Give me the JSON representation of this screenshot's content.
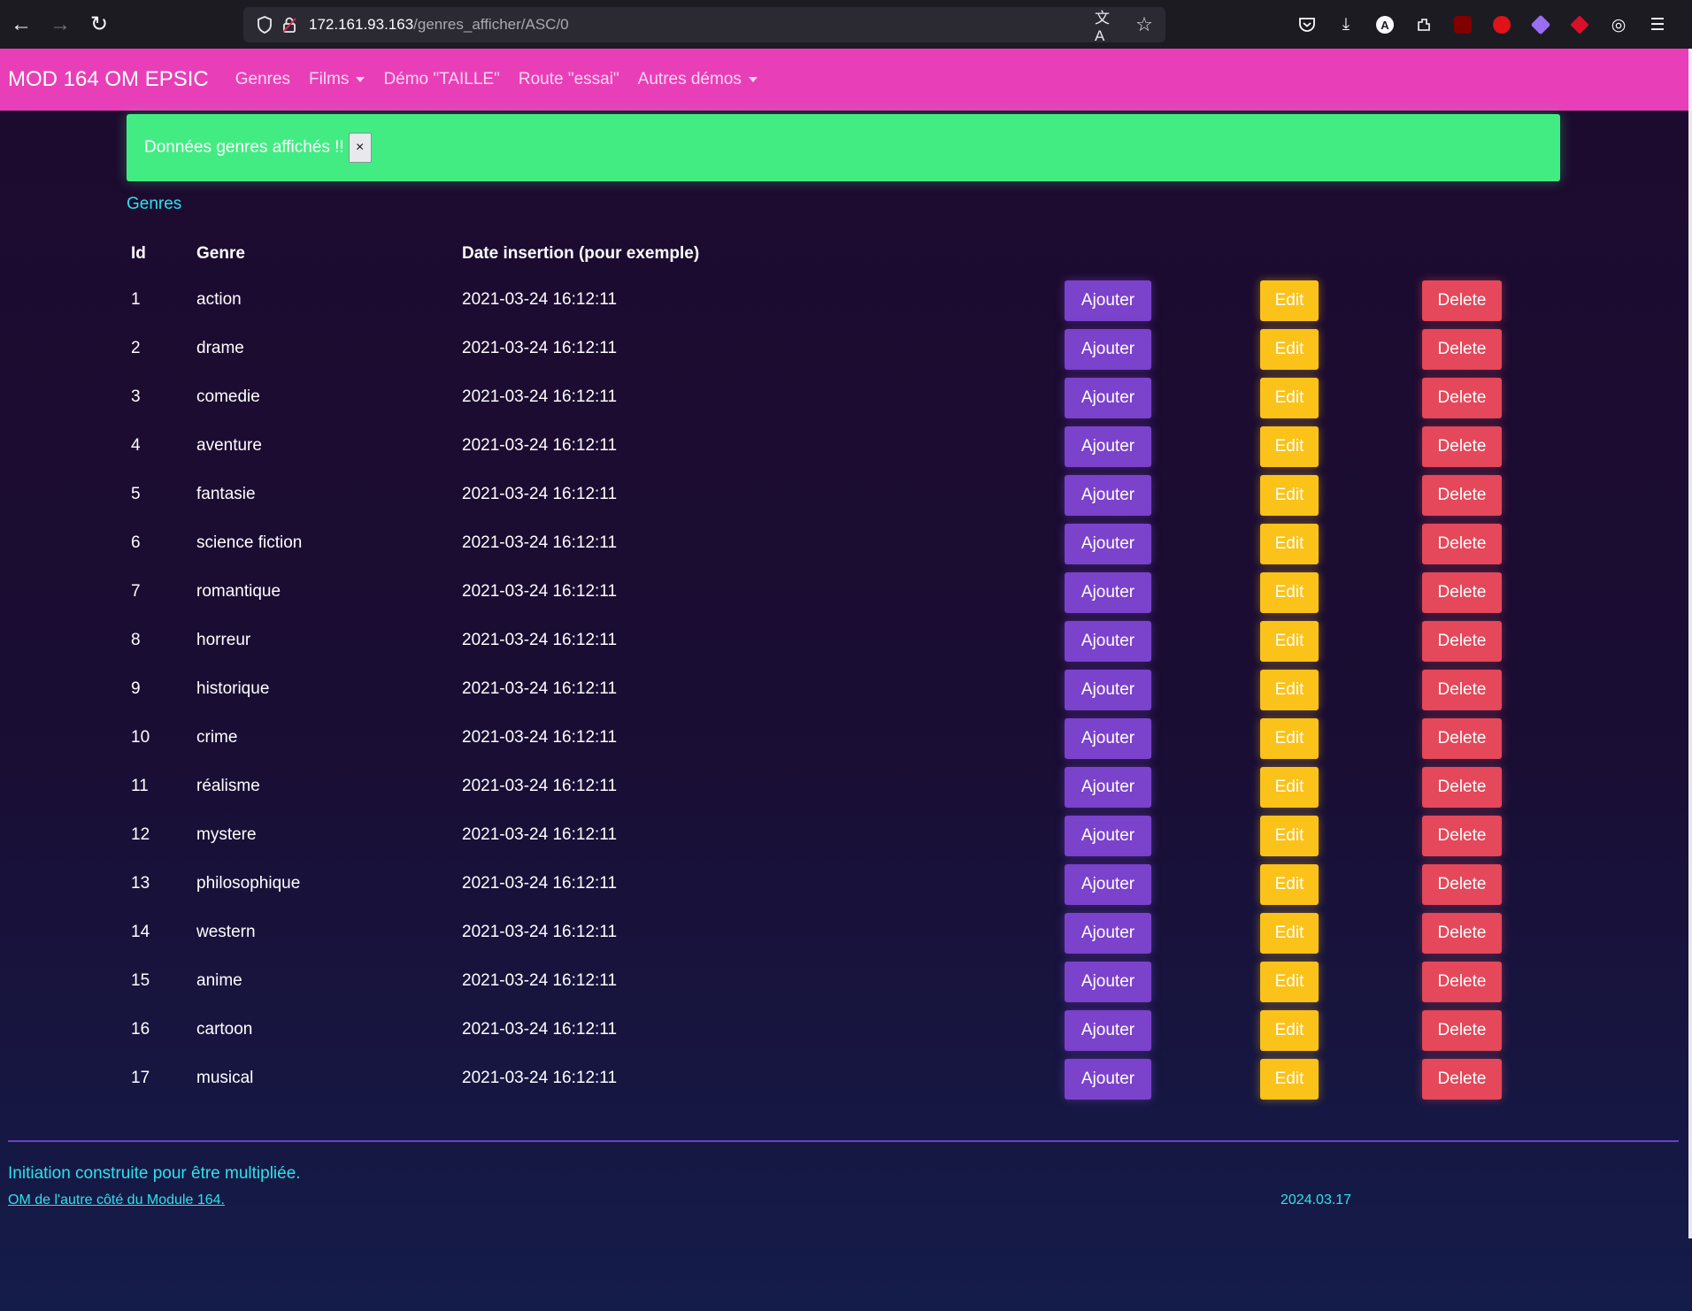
{
  "browser": {
    "url_host": "172.161.93.163",
    "url_path": "/genres_afficher/ASC/0"
  },
  "navbar": {
    "brand": "MOD 164 OM EPSIC",
    "items": [
      {
        "label": "Genres"
      },
      {
        "label": "Films"
      },
      {
        "label": "Démo \"TAILLE\""
      },
      {
        "label": "Route \"essai\""
      },
      {
        "label": "Autres démos"
      }
    ]
  },
  "alert": {
    "message": "Données genres affichés !!",
    "close": "×"
  },
  "section_title": "Genres",
  "table": {
    "headers": {
      "id": "Id",
      "genre": "Genre",
      "date": "Date insertion (pour exemple)"
    },
    "buttons": {
      "add": "Ajouter",
      "edit": "Edit",
      "delete": "Delete"
    },
    "rows": [
      {
        "id": "1",
        "genre": "action",
        "date": "2021-03-24 16:12:11"
      },
      {
        "id": "2",
        "genre": "drame",
        "date": "2021-03-24 16:12:11"
      },
      {
        "id": "3",
        "genre": "comedie",
        "date": "2021-03-24 16:12:11"
      },
      {
        "id": "4",
        "genre": "aventure",
        "date": "2021-03-24 16:12:11"
      },
      {
        "id": "5",
        "genre": "fantasie",
        "date": "2021-03-24 16:12:11"
      },
      {
        "id": "6",
        "genre": "science fiction",
        "date": "2021-03-24 16:12:11"
      },
      {
        "id": "7",
        "genre": "romantique",
        "date": "2021-03-24 16:12:11"
      },
      {
        "id": "8",
        "genre": "horreur",
        "date": "2021-03-24 16:12:11"
      },
      {
        "id": "9",
        "genre": "historique",
        "date": "2021-03-24 16:12:11"
      },
      {
        "id": "10",
        "genre": "crime",
        "date": "2021-03-24 16:12:11"
      },
      {
        "id": "11",
        "genre": "réalisme",
        "date": "2021-03-24 16:12:11"
      },
      {
        "id": "12",
        "genre": "mystere",
        "date": "2021-03-24 16:12:11"
      },
      {
        "id": "13",
        "genre": "philosophique",
        "date": "2021-03-24 16:12:11"
      },
      {
        "id": "14",
        "genre": "western",
        "date": "2021-03-24 16:12:11"
      },
      {
        "id": "15",
        "genre": "anime",
        "date": "2021-03-24 16:12:11"
      },
      {
        "id": "16",
        "genre": "cartoon",
        "date": "2021-03-24 16:12:11"
      },
      {
        "id": "17",
        "genre": "musical",
        "date": "2021-03-24 16:12:11"
      }
    ]
  },
  "footer": {
    "tagline": "Initiation construite pour être multipliée.",
    "link": "OM de l'autre côté du Module 164.",
    "date": "2024.03.17"
  },
  "colors": {
    "navbar": "#e83fb8",
    "alert": "#43ec83",
    "accent_cyan": "#2de2ea",
    "button_add": "#7b42cc",
    "button_edit": "#fbc21a",
    "button_delete": "#e4485a"
  },
  "icons": [
    "back-arrow-icon",
    "forward-arrow-icon",
    "reload-icon",
    "shield-icon",
    "lock-icon",
    "translate-icon",
    "star-icon",
    "pocket-icon",
    "download-icon",
    "account-icon",
    "extensions-icon",
    "menu-icon"
  ]
}
